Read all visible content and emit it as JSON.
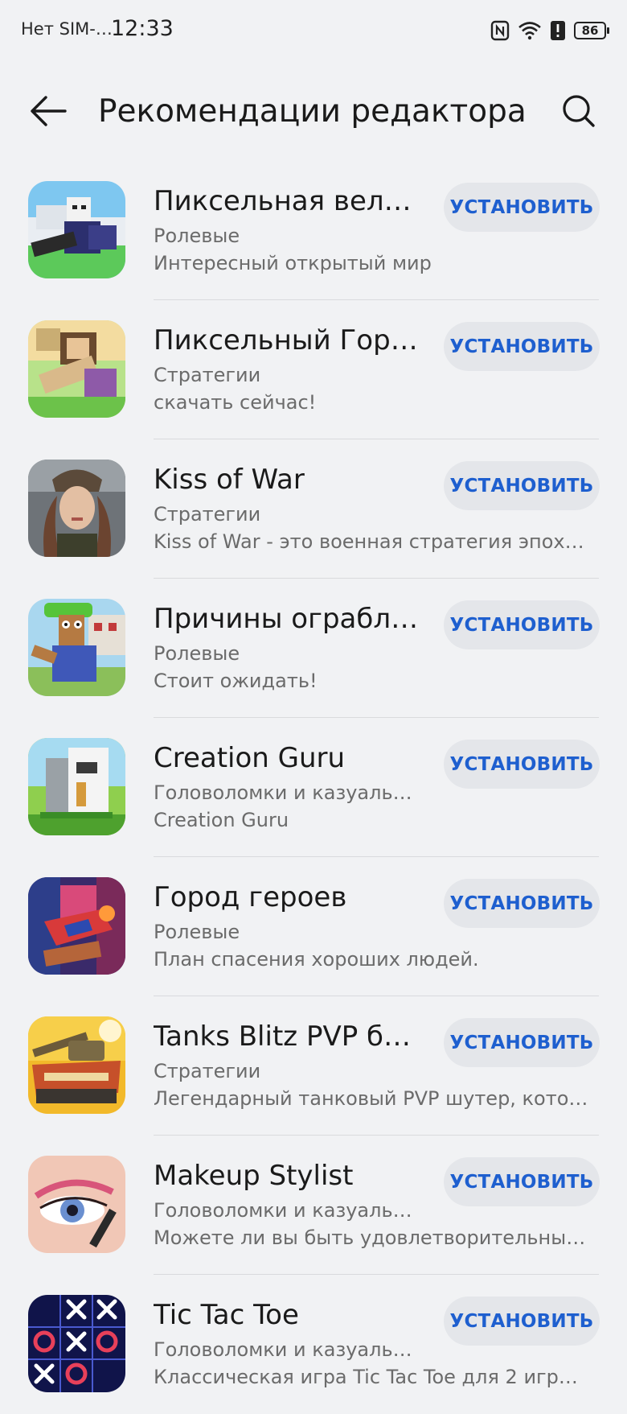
{
  "status_bar": {
    "carrier": "Нет SIM-…",
    "time": "12:33",
    "battery": "86",
    "icons": [
      "nfc-icon",
      "wifi-icon",
      "alert-icon",
      "battery-icon"
    ]
  },
  "header": {
    "title": "Рекомендации редактора",
    "back_icon": "back-arrow-icon",
    "search_icon": "search-icon"
  },
  "colors": {
    "background": "#f1f2f4",
    "button_bg": "#e4e6ea",
    "button_text": "#1e5fcf"
  },
  "apps": [
    {
      "name": "Пиксельная вели…",
      "category": "Ролевые",
      "description": "Интересный открытый мир",
      "button": "УСТАНОВИТЬ"
    },
    {
      "name": "Пиксельный Горо…",
      "category": "Стратегии",
      "description": "скачать сейчас!",
      "button": "УСТАНОВИТЬ"
    },
    {
      "name": "Kiss of War",
      "category": "Стратегии",
      "description": "Kiss of War - это военная стратегия эпохи…",
      "button": "УСТАНОВИТЬ"
    },
    {
      "name": "Причины ограбл…",
      "category": "Ролевые",
      "description": "Стоит ожидать!",
      "button": "УСТАНОВИТЬ"
    },
    {
      "name": "Creation Guru",
      "category": "Головоломки и казуальн…",
      "description": "Creation Guru",
      "button": "УСТАНОВИТЬ"
    },
    {
      "name": "Город героев",
      "category": "Ролевые",
      "description": "План спасения хороших людей.",
      "button": "УСТАНОВИТЬ"
    },
    {
      "name": "Tanks Blitz PVP би…",
      "category": "Стратегии",
      "description": "Легендарный танковый PVP шутер, котор…",
      "button": "УСТАНОВИТЬ"
    },
    {
      "name": "Makeup Stylist",
      "category": "Головоломки и казуальн…",
      "description": "Можете ли вы быть удовлетворительным…",
      "button": "УСТАНОВИТЬ"
    },
    {
      "name": "Tic Tac Toe",
      "category": "Головоломки и казуальн…",
      "description": "Классическая игра Tic Tac Toe для 2 игрок…",
      "button": "УСТАНОВИТЬ"
    }
  ]
}
